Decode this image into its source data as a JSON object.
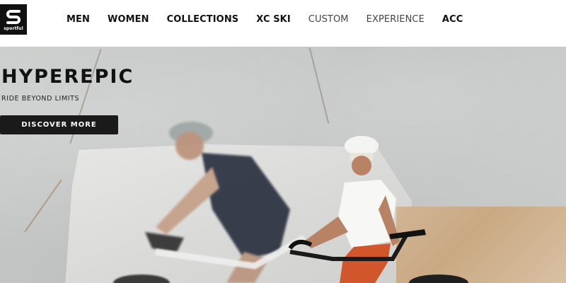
{
  "brand": {
    "logo_text": "sportful",
    "icon": "sportful-logo-icon"
  },
  "nav": {
    "items": [
      {
        "label": "MEN",
        "style": "bold"
      },
      {
        "label": "WOMEN",
        "style": "bold"
      },
      {
        "label": "COLLECTIONS",
        "style": "bold"
      },
      {
        "label": "XC SKI",
        "style": "bold"
      },
      {
        "label": "CUSTOM",
        "style": "light"
      },
      {
        "label": "EXPERIENCE",
        "style": "light"
      },
      {
        "label": "ACC",
        "style": "bold"
      }
    ]
  },
  "hero": {
    "title": "HYPEREPIC",
    "subtitle": "RIDE BEYOND LIMITS",
    "cta_label": "DISCOVER MORE",
    "image": "two cyclists riding road bikes in a marble quarry"
  },
  "colors": {
    "header_bg": "#ffffff",
    "logo_bg": "#111111",
    "cta_bg": "#1a1a1a",
    "text_primary": "#111111"
  }
}
